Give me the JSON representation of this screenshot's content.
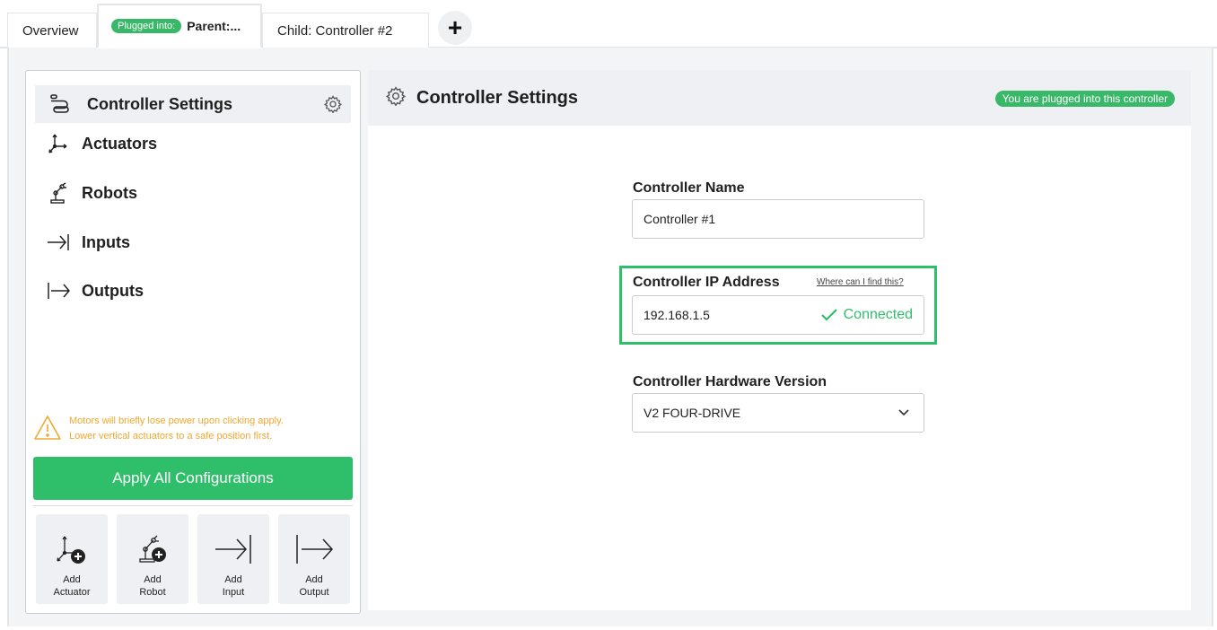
{
  "tabs": {
    "overview": "Overview",
    "parent_badge": "Plugged into:",
    "parent_label": "Parent:...",
    "child_label": "Child: Controller #2",
    "add_symbol": "+"
  },
  "sidebar": {
    "items": [
      {
        "label": "Controller Settings",
        "icon": "controller-icon"
      },
      {
        "label": "Actuators",
        "icon": "axes-icon"
      },
      {
        "label": "Robots",
        "icon": "robot-arm-icon"
      },
      {
        "label": "Inputs",
        "icon": "input-arrow-icon"
      },
      {
        "label": "Outputs",
        "icon": "output-arrow-icon"
      }
    ],
    "warning_line1": "Motors will briefly lose power upon clicking apply.",
    "warning_line2": "Lower vertical actuators to a safe position first.",
    "apply_label": "Apply All Configurations",
    "add_tiles": [
      {
        "line1": "Add",
        "line2": "Actuator"
      },
      {
        "line1": "Add",
        "line2": "Robot"
      },
      {
        "line1": "Add",
        "line2": "Input"
      },
      {
        "line1": "Add",
        "line2": "Output"
      }
    ]
  },
  "main": {
    "title": "Controller Settings",
    "status_pill": "You are plugged into this controller",
    "name_label": "Controller Name",
    "name_value": "Controller #1",
    "ip_label": "Controller IP Address",
    "ip_help": "Where can I find this?",
    "ip_value": "192.168.1.5",
    "ip_status": "Connected",
    "hw_label": "Controller Hardware Version",
    "hw_value": "V2 FOUR-DRIVE"
  },
  "colors": {
    "accent_green": "#2fbf6a",
    "warning_orange": "#f0a830",
    "panel_gray": "#eef0f3"
  }
}
